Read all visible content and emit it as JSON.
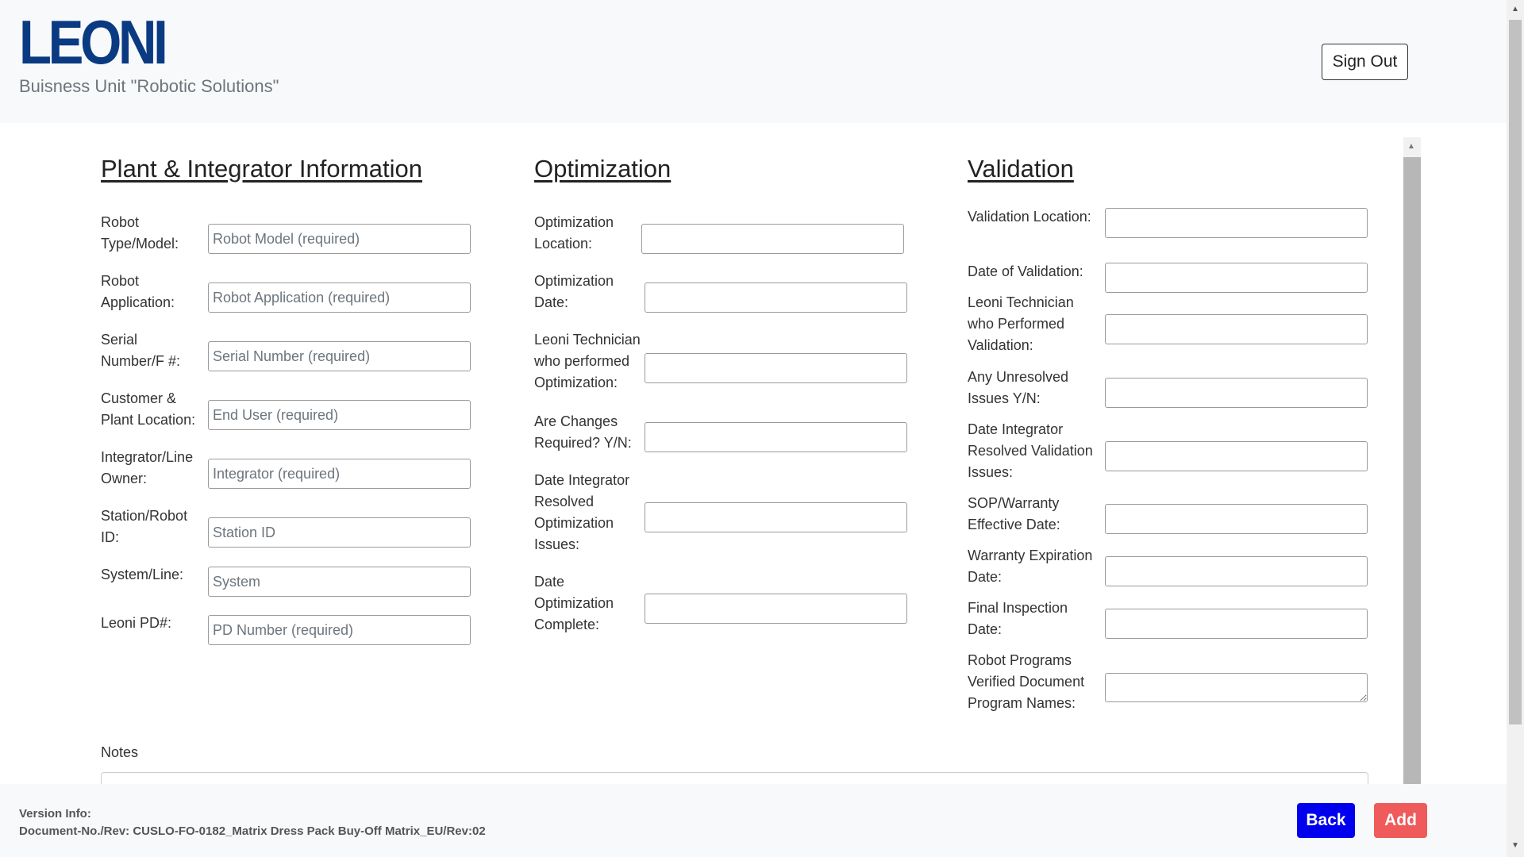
{
  "header": {
    "logo": "LEONI",
    "business_unit": "Buisness Unit \"Robotic Solutions\"",
    "signout_label": "Sign Out"
  },
  "plant": {
    "title": "Plant & Integrator Information",
    "fields": [
      {
        "label": "Robot Type/Model:",
        "placeholder": "Robot Model (required)"
      },
      {
        "label": "Robot Application:",
        "placeholder": "Robot Application (required)"
      },
      {
        "label": "Serial Number/F #:",
        "placeholder": "Serial Number (required)"
      },
      {
        "label": "Customer & Plant Location:",
        "placeholder": "End User (required)"
      },
      {
        "label": "Integrator/Line Owner:",
        "placeholder": "Integrator (required)"
      },
      {
        "label": "Station/Robot ID:",
        "placeholder": "Station ID"
      },
      {
        "label": "System/Line:",
        "placeholder": "System"
      },
      {
        "label": "Leoni PD#:",
        "placeholder": "PD Number (required)"
      }
    ]
  },
  "optimization": {
    "title": "Optimization",
    "fields": [
      {
        "label": "Optimization Location:"
      },
      {
        "label": "Optimization Date:"
      },
      {
        "label": "Leoni Technician who performed Optimization:"
      },
      {
        "label": "Are Changes Required? Y/N:"
      },
      {
        "label": "Date Integrator Resolved Optimization Issues:"
      },
      {
        "label": "Date Optimization Complete:"
      }
    ]
  },
  "validation": {
    "title": "Validation",
    "fields": [
      {
        "label": "Validation Location:"
      },
      {
        "label": "Date of Validation:"
      },
      {
        "label": "Leoni Technician who Performed Validation:"
      },
      {
        "label": "Any Unresolved Issues Y/N:"
      },
      {
        "label": "Date Integrator Resolved Validation Issues:"
      },
      {
        "label": "SOP/Warranty Effective Date:"
      },
      {
        "label": "Warranty Expiration Date:"
      },
      {
        "label": "Final Inspection Date:"
      },
      {
        "label": "Robot Programs Verified Document Program Names:"
      }
    ]
  },
  "notes": {
    "label": "Notes"
  },
  "footer": {
    "version_title": "Version Info:",
    "version_doc": "Document-No./Rev: CUSLO-FO-0182_Matrix Dress Pack Buy-Off Matrix_EU/Rev:02",
    "back_label": "Back",
    "add_label": "Add"
  },
  "colors": {
    "logo": "#0a3a82",
    "back_button": "#0000ee",
    "add_button": "#ef5a5a",
    "header_bg": "#f8f9fa"
  },
  "icons": {
    "scroll_up": "scroll-up-arrow-icon",
    "scroll_down": "scroll-down-arrow-icon"
  }
}
